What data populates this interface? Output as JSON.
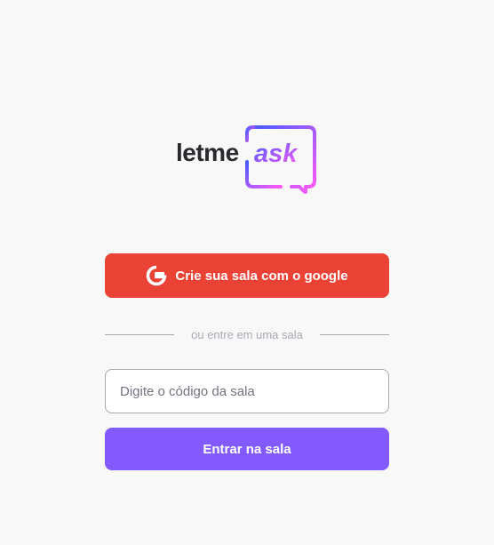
{
  "logo": {
    "word_primary": "letme",
    "word_accent": "ask"
  },
  "google_button": {
    "label": "Crie sua sala com o google",
    "icon": "google-g-icon"
  },
  "separator": {
    "text": "ou entre em uma sala"
  },
  "room_form": {
    "input_placeholder": "Digite o código da sala",
    "input_value": "",
    "submit_label": "Entrar na sala"
  },
  "colors": {
    "background": "#f8f8f8",
    "google": "#ea4335",
    "primary": "#835afd",
    "logo_text": "#29292e",
    "logo_gradient_start": "#485bff",
    "logo_gradient_end": "#ff59f8",
    "separator": "#a8a8b3"
  }
}
